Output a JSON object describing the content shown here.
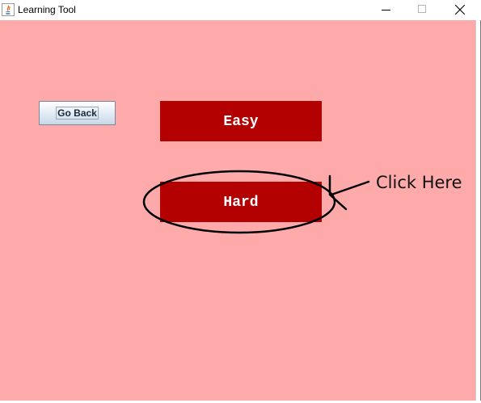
{
  "window": {
    "title": "Learning Tool",
    "controls": {
      "minimize": "minimize-icon",
      "maximize": "maximize-icon",
      "close": "close-icon"
    }
  },
  "content": {
    "background": "#ffaaaa",
    "go_back_label": "Go Back",
    "easy_label": "Easy",
    "hard_label": "Hard",
    "button_color": "#b30000"
  },
  "annotation": {
    "text": "Click Here",
    "shape": "ellipse-around-hard-with-arrow"
  }
}
